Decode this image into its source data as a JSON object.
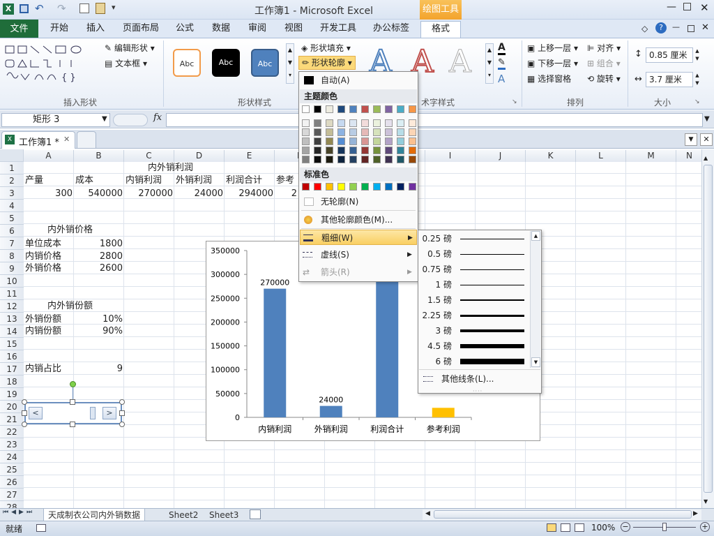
{
  "titlebar": {
    "title": "工作簿1 - Microsoft Excel",
    "context_tab": "绘图工具"
  },
  "ribbon_tabs": [
    "文件",
    "开始",
    "插入",
    "页面布局",
    "公式",
    "数据",
    "审阅",
    "视图",
    "开发工具",
    "办公标签",
    "格式"
  ],
  "ribbon": {
    "edit_shape": "编辑形状",
    "textbox": "文本框",
    "insert_shapes_label": "插入形状",
    "style_abc": [
      "Abc",
      "Abc",
      "Abc"
    ],
    "shape_styles_label": "形状样式",
    "shape_fill": "形状填充",
    "shape_outline": "形状轮廓",
    "art_styles_label": "术字样式",
    "bring_forward": "上移一层",
    "send_backward": "下移一层",
    "selection_pane": "选择窗格",
    "align": "对齐",
    "group": "组合",
    "rotate": "旋转",
    "arrange_label": "排列",
    "height": "0.85 厘米",
    "width": "3.7 厘米",
    "size_label": "大小"
  },
  "namebox": "矩形 3",
  "fx": "fx",
  "workbook_tab": "工作簿1 *",
  "columns": [
    "A",
    "B",
    "C",
    "D",
    "E",
    "F",
    "G",
    "H",
    "I",
    "J",
    "K",
    "L",
    "M",
    "N"
  ],
  "rows": [
    "1",
    "2",
    "3",
    "4",
    "5",
    "6",
    "7",
    "8",
    "9",
    "10",
    "11",
    "12",
    "13",
    "14",
    "15",
    "16",
    "17",
    "18",
    "19",
    "20",
    "21",
    "22",
    "23",
    "24",
    "25",
    "26",
    "27",
    "28"
  ],
  "cells": {
    "c1": "内外销利润",
    "a2": "产量",
    "b2": "成本",
    "c2": "内销利润",
    "d2": "外销利润",
    "e2": "利润合计",
    "f2": "参考",
    "a3": "300",
    "b3": "540000",
    "c3": "270000",
    "d3": "24000",
    "e3": "294000",
    "f3": "2",
    "a6": "内外销价格",
    "a7": "单位成本",
    "b7": "1800",
    "a8": "内销价格",
    "b8": "2800",
    "a9": "外销价格",
    "b9": "2600",
    "a12": "内外销份额",
    "a13": "外销份额",
    "b13": "10%",
    "a14": "内销份额",
    "b14": "90%",
    "a17": "内销占比",
    "b17": "9"
  },
  "outline_menu": {
    "auto": "自动(A)",
    "theme_colors": "主题颜色",
    "standard_colors": "标准色",
    "no_outline": "无轮廓(N)",
    "more_colors": "其他轮廓颜色(M)...",
    "weight": "粗细(W)",
    "dashes": "虚线(S)",
    "arrows": "箭头(R)"
  },
  "theme_row": [
    "#ffffff",
    "#000000",
    "#eeece1",
    "#1f497d",
    "#4f81bd",
    "#c0504d",
    "#9bbb59",
    "#8064a2",
    "#4bacc6",
    "#f79646"
  ],
  "theme_shades": [
    [
      "#f2f2f2",
      "#7f7f7f",
      "#ddd9c3",
      "#c6d9f0",
      "#dbe5f1",
      "#f2dcdb",
      "#ebf1dd",
      "#e5e0ec",
      "#dbeef3",
      "#fdeada"
    ],
    [
      "#d8d8d8",
      "#595959",
      "#c4bd97",
      "#8db3e2",
      "#b8cce4",
      "#e5b9b7",
      "#d7e3bc",
      "#ccc1d9",
      "#b7dde8",
      "#fbd5b5"
    ],
    [
      "#bfbfbf",
      "#3f3f3f",
      "#938953",
      "#548dd4",
      "#95b3d7",
      "#d99694",
      "#c3d69b",
      "#b2a2c7",
      "#92cddc",
      "#fac08f"
    ],
    [
      "#a5a5a5",
      "#262626",
      "#494429",
      "#17365d",
      "#366092",
      "#953734",
      "#76923c",
      "#5f497a",
      "#31859b",
      "#e36c09"
    ],
    [
      "#7f7f7f",
      "#0c0c0c",
      "#1d1b10",
      "#0f243e",
      "#244061",
      "#632423",
      "#4f6128",
      "#3f3151",
      "#205867",
      "#974806"
    ]
  ],
  "standard_row": [
    "#c00000",
    "#ff0000",
    "#ffc000",
    "#ffff00",
    "#92d050",
    "#00b050",
    "#00b0f0",
    "#0070c0",
    "#002060",
    "#7030a0"
  ],
  "weights": [
    {
      "label": "0.25 磅",
      "pt": 0.25
    },
    {
      "label": "0.5 磅",
      "pt": 0.5
    },
    {
      "label": "0.75 磅",
      "pt": 0.75
    },
    {
      "label": "1 磅",
      "pt": 1
    },
    {
      "label": "1.5 磅",
      "pt": 1.5
    },
    {
      "label": "2.25 磅",
      "pt": 2.25
    },
    {
      "label": "3 磅",
      "pt": 3
    },
    {
      "label": "4.5 磅",
      "pt": 4.5
    },
    {
      "label": "6 磅",
      "pt": 6
    }
  ],
  "more_lines": "其他线条(L)...",
  "chart_data": {
    "type": "bar",
    "categories": [
      "内销利润",
      "外销利润",
      "利润合计",
      "参考利润"
    ],
    "values": [
      270000,
      24000,
      294000,
      20000
    ],
    "data_labels": [
      "270000",
      "24000",
      "",
      ""
    ],
    "yticks": [
      "0",
      "50000",
      "100000",
      "150000",
      "200000",
      "250000",
      "300000",
      "350000"
    ],
    "ylim": [
      0,
      350000
    ],
    "colors": [
      "#4f81bd",
      "#4f81bd",
      "#4f81bd",
      "#ffc000"
    ]
  },
  "sheets": [
    "天成制衣公司内外销数据",
    "Sheet2",
    "Sheet3"
  ],
  "status": {
    "ready": "就绪",
    "zoom": "100%"
  }
}
